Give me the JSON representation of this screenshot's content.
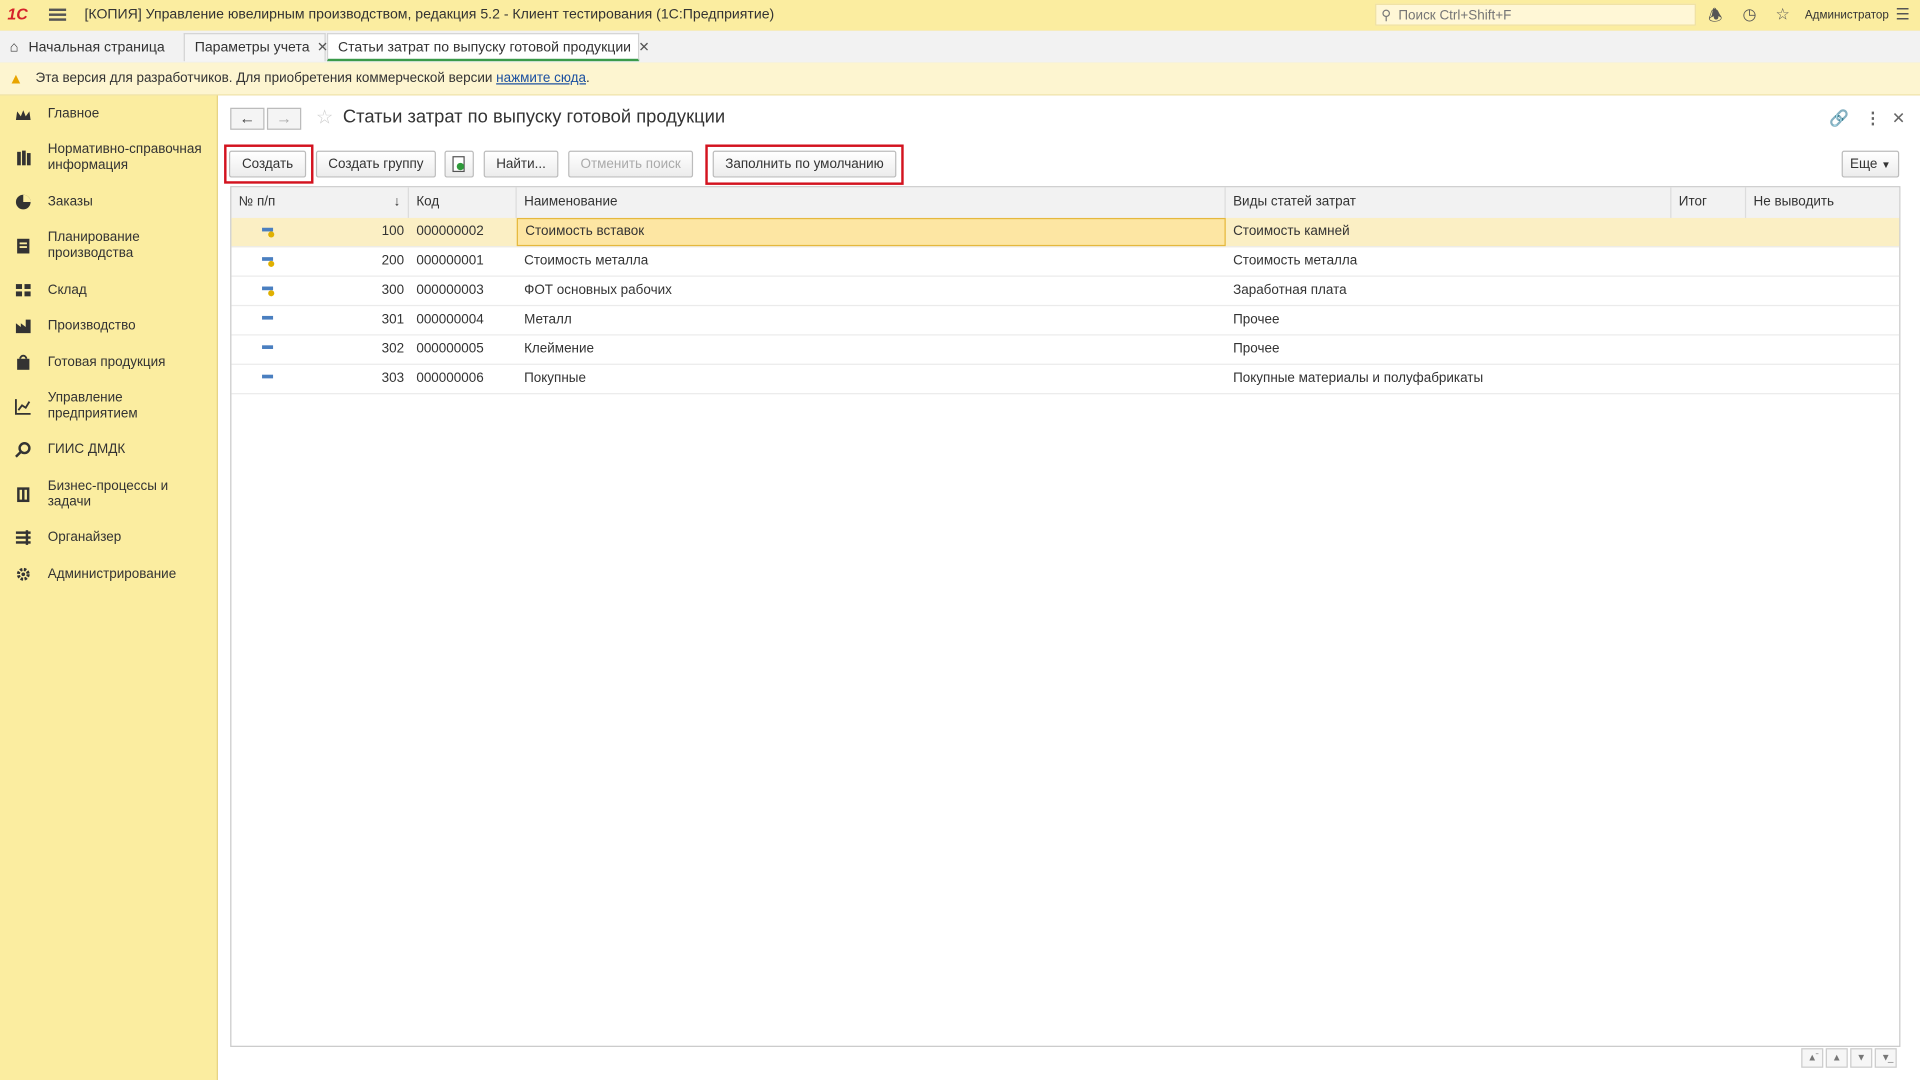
{
  "titlebar": {
    "logo": "1С",
    "title": "[КОПИЯ] Управление ювелирным производством, редакция 5.2  - Клиент тестирования (1С:Предприятие)",
    "search_placeholder": "Поиск Ctrl+Shift+F",
    "user": "Администратор"
  },
  "tabs": [
    {
      "label": "Начальная страница"
    },
    {
      "label": "Параметры учета"
    },
    {
      "label": "Статьи затрат по выпуску готовой продукции"
    }
  ],
  "dev_banner": {
    "text": "Эта версия для разработчиков. Для приобретения коммерческой версии ",
    "link": "нажмите сюда",
    "suffix": "."
  },
  "sidebar": {
    "items": [
      {
        "label": "Главное",
        "icon": "crown-icon"
      },
      {
        "label": "Нормативно-справочная информация",
        "icon": "books-icon"
      },
      {
        "label": "Заказы",
        "icon": "pie-chart-icon"
      },
      {
        "label": "Планирование производства",
        "icon": "planning-icon"
      },
      {
        "label": "Склад",
        "icon": "warehouse-icon"
      },
      {
        "label": "Производство",
        "icon": "factory-icon"
      },
      {
        "label": "Готовая продукция",
        "icon": "bag-icon"
      },
      {
        "label": "Управление предприятием",
        "icon": "chart-icon"
      },
      {
        "label": "ГИИС ДМДК",
        "icon": "gear-link-icon"
      },
      {
        "label": "Бизнес-процессы и задачи",
        "icon": "process-icon"
      },
      {
        "label": "Органайзер",
        "icon": "organizer-icon"
      },
      {
        "label": "Администрирование",
        "icon": "admin-gear-icon"
      }
    ]
  },
  "form": {
    "title": "Статьи затрат по выпуску готовой продукции",
    "buttons": {
      "create": "Создать",
      "create_group": "Создать группу",
      "find": "Найти...",
      "cancel_search": "Отменить поиск",
      "fill_default": "Заполнить по умолчанию",
      "more": "Еще"
    }
  },
  "table": {
    "columns": [
      "№ п/п",
      "Код",
      "Наименование",
      "Виды статей затрат",
      "Итог",
      "Не выводить"
    ],
    "rows": [
      {
        "icon": "item-with-marker-icon",
        "num": "100",
        "code": "000000002",
        "name": "Стоимость вставок",
        "kind": "Стоимость камней",
        "total": "",
        "hide": ""
      },
      {
        "icon": "item-with-marker-icon",
        "num": "200",
        "code": "000000001",
        "name": "Стоимость металла",
        "kind": "Стоимость металла",
        "total": "",
        "hide": ""
      },
      {
        "icon": "item-with-marker-icon",
        "num": "300",
        "code": "000000003",
        "name": "ФОТ основных рабочих",
        "kind": "Заработная плата",
        "total": "",
        "hide": ""
      },
      {
        "icon": "item-icon",
        "num": "301",
        "code": "000000004",
        "name": "Металл",
        "kind": "Прочее",
        "total": "",
        "hide": ""
      },
      {
        "icon": "item-icon",
        "num": "302",
        "code": "000000005",
        "name": "Клеймение",
        "kind": "Прочее",
        "total": "",
        "hide": ""
      },
      {
        "icon": "item-icon",
        "num": "303",
        "code": "000000006",
        "name": "Покупные",
        "kind": "Покупные материалы и полуфабрикаты",
        "total": "",
        "hide": ""
      }
    ]
  },
  "colors": {
    "accent_yellow": "#fbeda0",
    "selection": "#fbefc4",
    "highlight_border": "#d3131f",
    "active_tab": "#3a9a4a"
  }
}
